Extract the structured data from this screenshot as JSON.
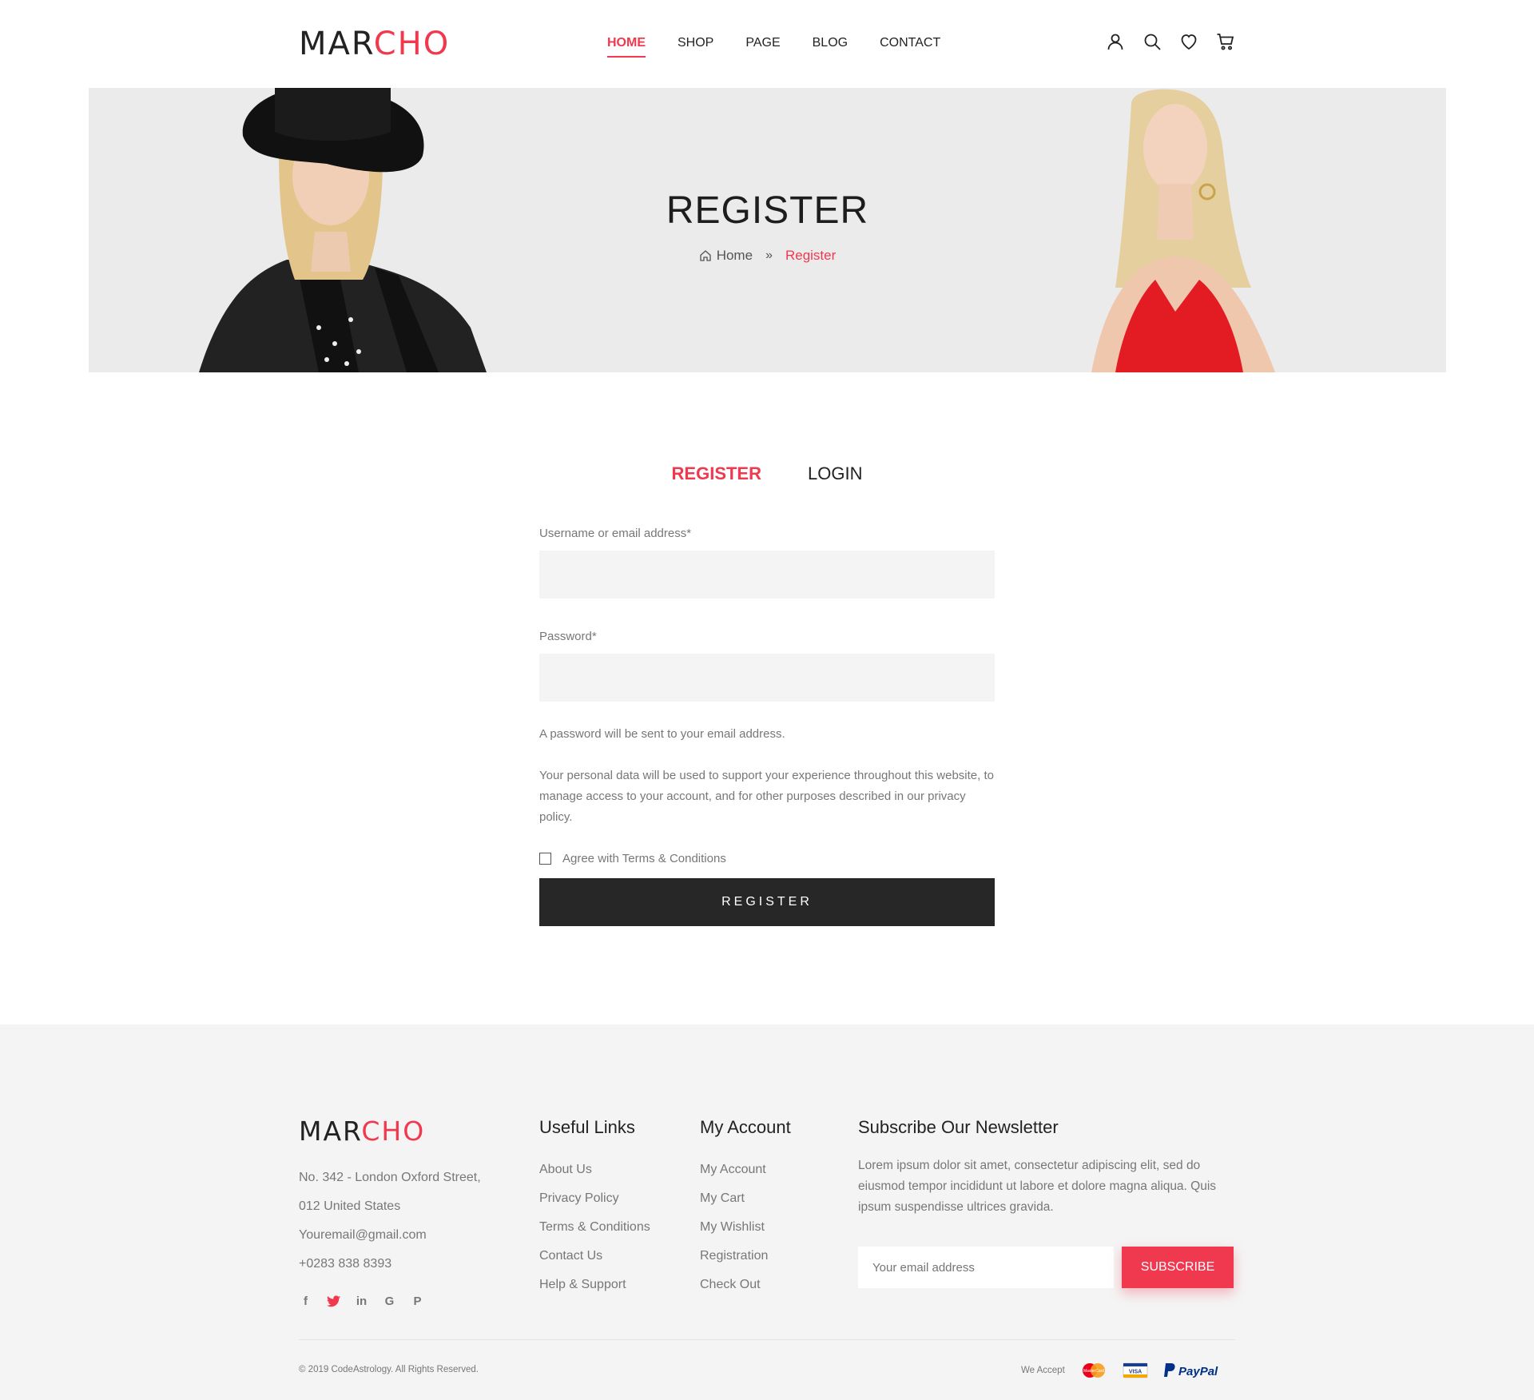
{
  "brand": {
    "logo_part1": "MAR",
    "logo_part2": "CHO",
    "accent": "#f0394e",
    "dark": "#272727"
  },
  "nav": {
    "items": [
      {
        "label": "HOME",
        "active": true
      },
      {
        "label": "SHOP"
      },
      {
        "label": "PAGE"
      },
      {
        "label": "BLOG"
      },
      {
        "label": "CONTACT"
      }
    ],
    "icons": [
      "user-icon",
      "search-icon",
      "heart-icon",
      "cart-icon"
    ]
  },
  "hero": {
    "title": "REGISTER",
    "breadcrumb_home": "Home",
    "breadcrumb_current": "Register"
  },
  "tabs": {
    "register": "REGISTER",
    "login": "LOGIN"
  },
  "form": {
    "username_label": "Username or email address*",
    "username_value": "",
    "password_label": "Password*",
    "password_value": "",
    "password_note": "A password will be sent to your email address.",
    "privacy_text": "Your personal data will be used to support your experience throughout this website, to manage access to your account, and for other purposes described in our privacy policy.",
    "agree_label": "Agree with Terms & Conditions",
    "submit_label": "REGISTER"
  },
  "footer": {
    "address_line1": "No. 342 - London Oxford Street,",
    "address_line2": "012 United States",
    "email": "Youremail@gmail.com",
    "phone": "+0283 838 8393",
    "socials": [
      "facebook-icon",
      "twitter-icon",
      "linkedin-icon",
      "google-icon",
      "pinterest-icon"
    ],
    "useful_title": "Useful Links",
    "useful_links": [
      "About Us",
      "Privacy Policy",
      "Terms & Conditions",
      "Contact Us",
      "Help & Support"
    ],
    "account_title": "My Account",
    "account_links": [
      "My Account",
      "My Cart",
      "My Wishlist",
      "Registration",
      "Check Out"
    ],
    "newsletter_title": "Subscribe Our Newsletter",
    "newsletter_text": "Lorem ipsum dolor sit amet, consectetur adipiscing elit, sed do eiusmod tempor incididunt ut labore et dolore magna aliqua. Quis ipsum suspendisse ultrices gravida.",
    "newsletter_placeholder": "Your email address",
    "subscribe_label": "SUBSCRIBE",
    "copyright": "© 2019 CodeAstrology. All Rights Reserved.",
    "we_accept": "We Accept",
    "paypal_label": "PayPal",
    "visa_label": "VISA",
    "mastercard_label": "MasterCard"
  }
}
